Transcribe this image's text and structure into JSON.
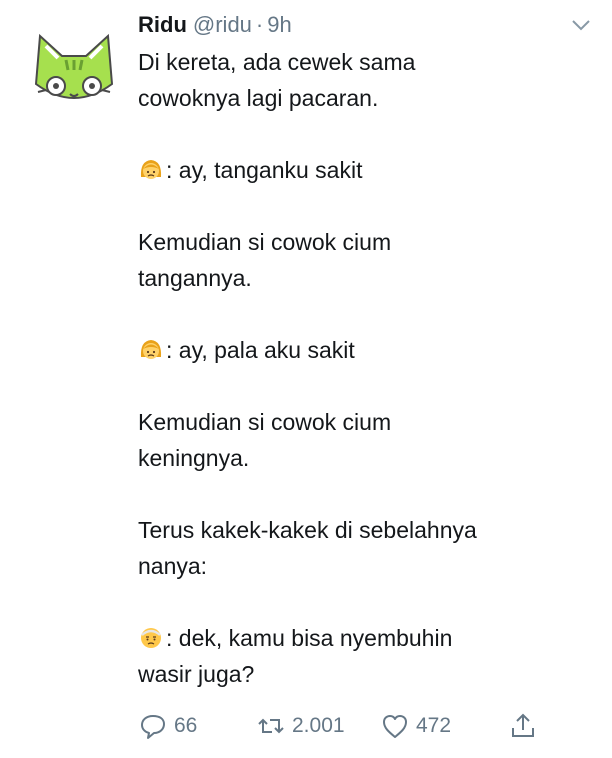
{
  "tweet": {
    "author_name": "Ridu",
    "handle": "@ridu",
    "separator": "·",
    "time": "9h",
    "lines": {
      "l1": "Di kereta, ada cewek sama",
      "l2": "cowoknya lagi pacaran.",
      "l3": ": ay, tanganku sakit",
      "l4": "Kemudian si cowok cium",
      "l5": "tangannya.",
      "l6": ": ay, pala aku sakit",
      "l7": "Kemudian si cowok cium",
      "l8": "keningnya.",
      "l9": "Terus kakek-kakek di sebelahnya",
      "l10": "nanya:",
      "l11": ": dek, kamu bisa nyembuhin",
      "l12": "wasir juga?"
    }
  },
  "actions": {
    "replies": "66",
    "retweets": "2.001",
    "likes": "472"
  },
  "icons": {
    "avatar": "cat-face-avatar",
    "menu": "chevron-down-icon",
    "woman_emoji": "woman-emoji-icon",
    "old_man_emoji": "old-man-emoji-icon",
    "reply": "reply-icon",
    "retweet": "retweet-icon",
    "like": "heart-icon",
    "share": "share-icon"
  },
  "colors": {
    "text": "#14171a",
    "secondary": "#657786",
    "avatar_green": "#a6e04e"
  }
}
